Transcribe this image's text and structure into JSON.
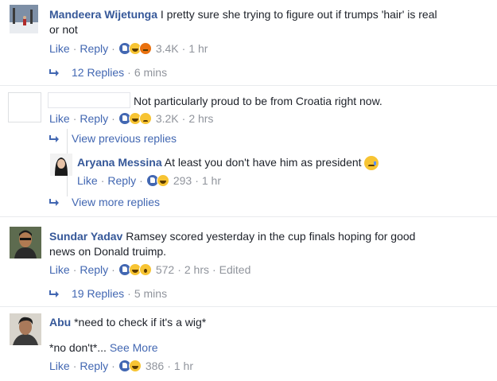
{
  "comments": [
    {
      "author": "Mandeera Wijetunga",
      "text_line1": "I pretty sure she trying to figure out if trumps 'hair' is real",
      "text_line2": "or not",
      "like": "Like",
      "reply": "Reply",
      "reaction_count": "3.4K",
      "time": "1 hr",
      "replies_label": "12 Replies",
      "replies_time": "6 mins"
    },
    {
      "author": "",
      "text": "Not particularly proud to be from Croatia right now.",
      "like": "Like",
      "reply": "Reply",
      "reaction_count": "3.2K",
      "time": "2 hrs",
      "view_previous": "View previous replies",
      "nested_reply": {
        "author": "Aryana Messina",
        "text": "At least you don't have him as president",
        "like": "Like",
        "reply": "Reply",
        "reaction_count": "293",
        "time": "1 hr"
      },
      "view_more": "View more replies"
    },
    {
      "author": "Sundar Yadav",
      "text_line1": "Ramsey scored yesterday in the cup finals hoping for good",
      "text_line2": "news on Donald truimp.",
      "like": "Like",
      "reply": "Reply",
      "reaction_count": "572",
      "time": "2 hrs",
      "edited": "Edited",
      "replies_label": "19 Replies",
      "replies_time": "5 mins"
    },
    {
      "author": "Abu",
      "text_line1": "*need to check if it's a wig*",
      "text_line2": "*no don't*...",
      "see_more": "See More",
      "like": "Like",
      "reply": "Reply",
      "reaction_count": "386",
      "time": "1 hr"
    }
  ],
  "separator": "·",
  "colors": {
    "link": "#4267b2",
    "name": "#365899",
    "meta": "#90949c",
    "text": "#1d2129"
  }
}
